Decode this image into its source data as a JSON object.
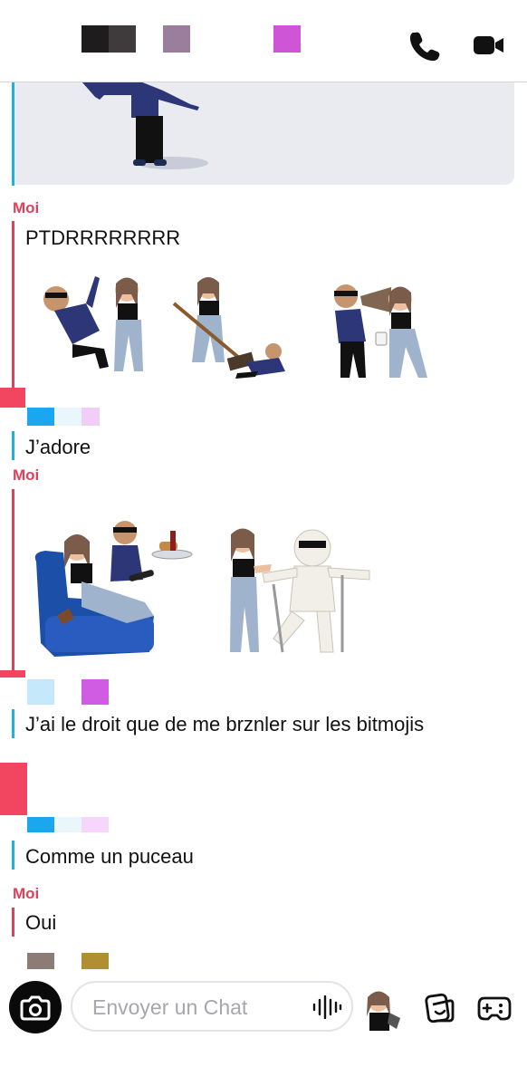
{
  "header": {
    "censor_colors": [
      "#1a1a1a",
      "#403c3e",
      "#9b7e9b",
      "#cd55d6"
    ],
    "call_icon": "phone-icon",
    "video_icon": "video-camera-icon"
  },
  "messages": [
    {
      "sender": "Moi",
      "text": "PTDRRRRRRRR"
    },
    {
      "sender": "",
      "text": "J’adore"
    },
    {
      "sender": "Moi",
      "text": ""
    },
    {
      "sender": "",
      "text": "J’ai le droit que de me brznler sur les bitmojis"
    },
    {
      "sender": "",
      "text": "Comme un puceau"
    },
    {
      "sender": "Moi",
      "text": "Oui"
    }
  ],
  "composer": {
    "placeholder": "Envoyer un Chat",
    "camera_icon": "camera-icon",
    "voice_icon": "voice-waveform-icon",
    "bitmoji_icon": "bitmoji-icon",
    "sticker_icon": "sticker-icon",
    "games_icon": "gamepad-icon"
  },
  "colors": {
    "me_accent": "#e0405a",
    "friend_accent": "#1eb0e6"
  }
}
